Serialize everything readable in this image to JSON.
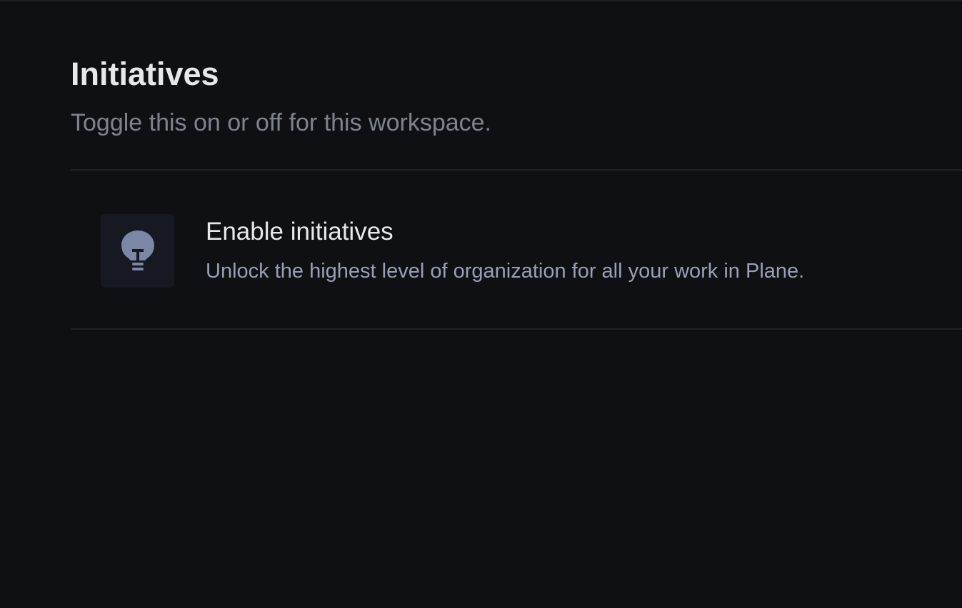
{
  "page": {
    "title": "Initiatives",
    "subtitle": "Toggle this on or off for this workspace."
  },
  "feature": {
    "icon": "lightbulb-icon",
    "title": "Enable initiatives",
    "description": "Unlock the highest level of organization for all your work in Plane."
  },
  "colors": {
    "background": "#0e1014",
    "icon": "#7c86a5"
  }
}
